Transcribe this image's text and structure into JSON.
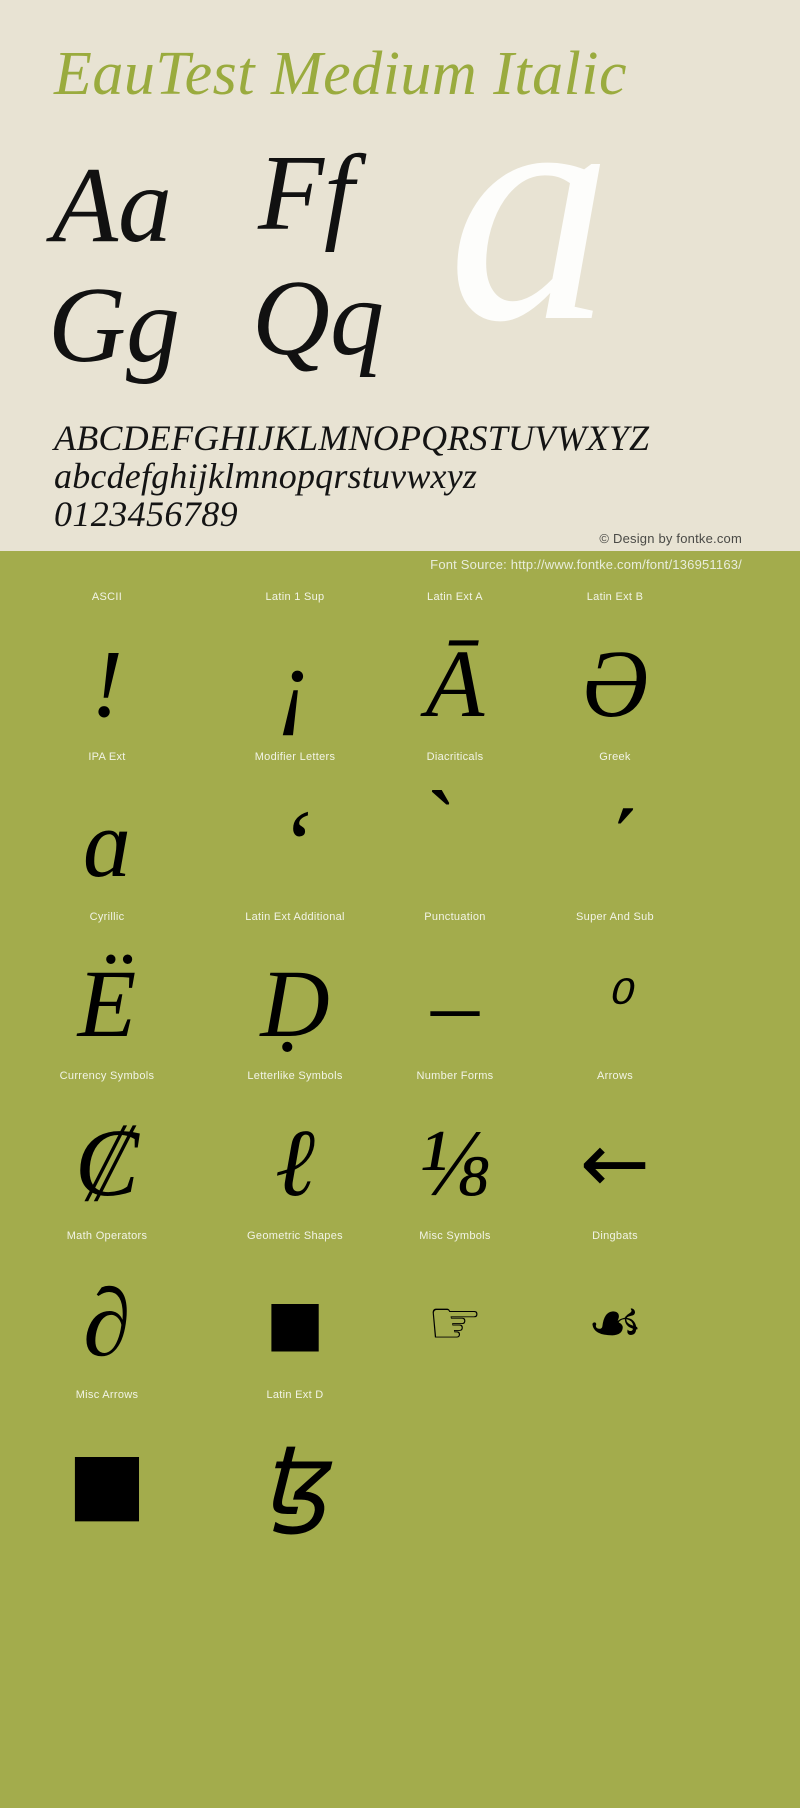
{
  "title": "EauTest Medium Italic",
  "watermark_letter": "a",
  "letter_pairs": [
    "Aa",
    "Ff",
    "Gg",
    "Qq"
  ],
  "alphabet": {
    "uppercase": "ABCDEFGHIJKLMNOPQRSTUVWXYZ",
    "lowercase": "abcdefghijklmnopqrstuvwxyz",
    "digits": "0123456789"
  },
  "copyright": "© Design by fontke.com",
  "font_source": "Font Source: http://www.fontke.com/font/136951163/",
  "colors": {
    "background": "#e8e3d3",
    "accent_green": "#a3ac4c",
    "title_green": "#9aab3e",
    "glyph_black": "#000000",
    "label_white": "#f2f4e6"
  },
  "unicode_rows": [
    {
      "cells": [
        {
          "label": "ASCII",
          "glyph": "!"
        },
        {
          "label": "Latin 1 Sup",
          "glyph": "¡"
        },
        {
          "label": "Latin Ext A",
          "glyph": "Ā"
        },
        {
          "label": "Latin Ext B",
          "glyph": "Ə"
        }
      ]
    },
    {
      "cells": [
        {
          "label": "IPA Ext",
          "glyph": "ɑ"
        },
        {
          "label": "Modifier Letters",
          "glyph": "ʻ"
        },
        {
          "label": "Diacriticals",
          "glyph": "̀"
        },
        {
          "label": "Greek",
          "glyph": "ʹ"
        }
      ]
    },
    {
      "cells": [
        {
          "label": "Cyrillic",
          "glyph": "Ё"
        },
        {
          "label": "Latin Ext Additional",
          "glyph": "Ḍ"
        },
        {
          "label": "Punctuation",
          "glyph": "–"
        },
        {
          "label": "Super And Sub",
          "glyph": "⁰"
        }
      ]
    },
    {
      "cells": [
        {
          "label": "Currency Symbols",
          "glyph": "₡"
        },
        {
          "label": "Letterlike Symbols",
          "glyph": "ℓ"
        },
        {
          "label": "Number Forms",
          "glyph": "⅛"
        },
        {
          "label": "Arrows",
          "glyph": "←"
        }
      ]
    },
    {
      "cells": [
        {
          "label": "Math Operators",
          "glyph": "∂"
        },
        {
          "label": "Geometric Shapes",
          "glyph": "■"
        },
        {
          "label": "Misc Symbols",
          "glyph": "☞"
        },
        {
          "label": "Dingbats",
          "glyph": "☙"
        }
      ]
    },
    {
      "cells": [
        {
          "label": "Misc Arrows",
          "glyph": "■"
        },
        {
          "label": "Latin Ext D",
          "glyph": "ꜩ"
        }
      ]
    }
  ]
}
